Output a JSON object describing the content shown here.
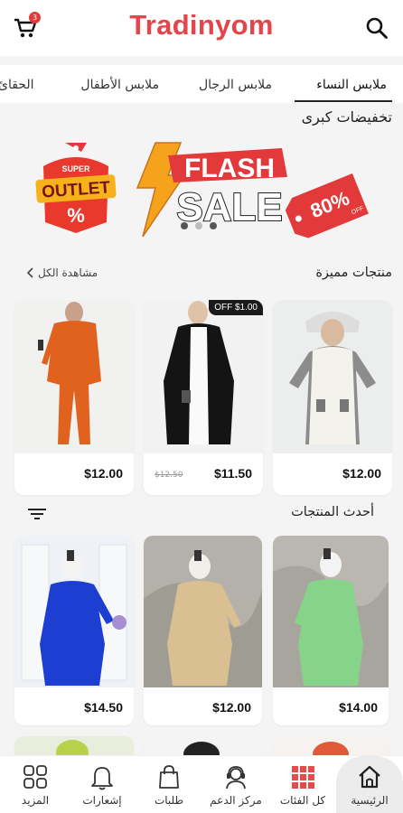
{
  "header": {
    "brand": "Tradinyom",
    "cart_count": "3",
    "cart_icon": "cart-icon",
    "search_icon": "search-icon",
    "brand_color": "#e3454a"
  },
  "tabs": [
    {
      "label": "ملابس النساء",
      "active": true
    },
    {
      "label": "ملابس الرجال",
      "active": false
    },
    {
      "label": "ملابس الأطفال",
      "active": false
    },
    {
      "label": "الحقائ",
      "active": false
    }
  ],
  "sale": {
    "title": "تخفيضات كبرى",
    "banner": {
      "badge_top": "SUPER",
      "badge_main": "OUTLET",
      "badge_pct": "%",
      "flash": "FLASH",
      "sale": "SALE",
      "tag_value": "80%",
      "tag_off": "OFF"
    }
  },
  "featured": {
    "title": "منتجات مميزة",
    "view_all": "مشاهدة الكل",
    "products": [
      {
        "price": "$12.00",
        "old_price": "",
        "badge": "",
        "image": "woman-white-knit-dress"
      },
      {
        "price": "$11.50",
        "old_price": "$12.50",
        "badge": "OFF $1.00",
        "image": "woman-black-blazer"
      },
      {
        "price": "$12.00",
        "old_price": "",
        "badge": "",
        "image": "woman-orange-suit"
      }
    ]
  },
  "latest": {
    "title": "أحدث المنتجات",
    "products": [
      {
        "price": "$14.00",
        "image": "woman-green-tunic"
      },
      {
        "price": "$12.00",
        "image": "woman-beige-tunic"
      },
      {
        "price": "$14.50",
        "image": "woman-blue-tunic"
      }
    ]
  },
  "bottom_nav": [
    {
      "label": "الرئيسية",
      "icon": "home-icon",
      "active": true
    },
    {
      "label": "كل الفئات",
      "icon": "grid-icon",
      "active": false
    },
    {
      "label": "مركز الدعم",
      "icon": "support-agent-icon",
      "active": false
    },
    {
      "label": "طلبات",
      "icon": "shopping-bag-icon",
      "active": false
    },
    {
      "label": "إشعارات",
      "icon": "bell-icon",
      "active": false
    },
    {
      "label": "المزيد",
      "icon": "more-grid-icon",
      "active": false
    }
  ],
  "colors": {
    "accent": "#e3454a",
    "nav_grid": "#e84a4a"
  }
}
